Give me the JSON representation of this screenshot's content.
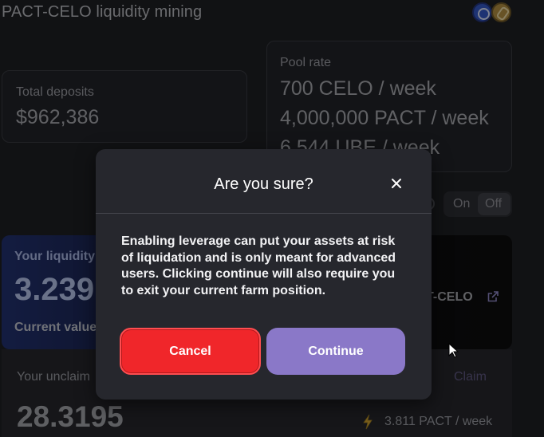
{
  "page": {
    "title": "PACT-CELO liquidity mining",
    "token_icons": [
      "celo-token-icon",
      "pact-token-icon"
    ]
  },
  "stats": {
    "total_deposits_label": "Total deposits",
    "total_deposits_value": "$962,386",
    "pool_rate_label": "Pool rate",
    "pool_rates": [
      "700 CELO / week",
      "4,000,000 PACT / week",
      "6,544 UBE / week"
    ]
  },
  "leverage": {
    "on_label": "On",
    "off_label": "Off",
    "selected": "Off"
  },
  "liquidity": {
    "label": "Your liquidity",
    "value": "3.239",
    "current_value_label": "Current value",
    "pair_label": "T-CELO"
  },
  "unclaimed": {
    "label": "Your unclaim",
    "claim_label": "Claim",
    "value": "28.3195",
    "rate": "3.811 PACT / week"
  },
  "modal": {
    "title": "Are you sure?",
    "body": "Enabling leverage can put your assets at risk of liquidation and is only meant for advanced users. Clicking continue will also require you to exit your current farm position.",
    "cancel_label": "Cancel",
    "continue_label": "Continue"
  },
  "colors": {
    "cancel": "#f0262a",
    "continue": "#8a78c8",
    "modal_bg": "#26272d",
    "page_bg": "#17181c"
  }
}
